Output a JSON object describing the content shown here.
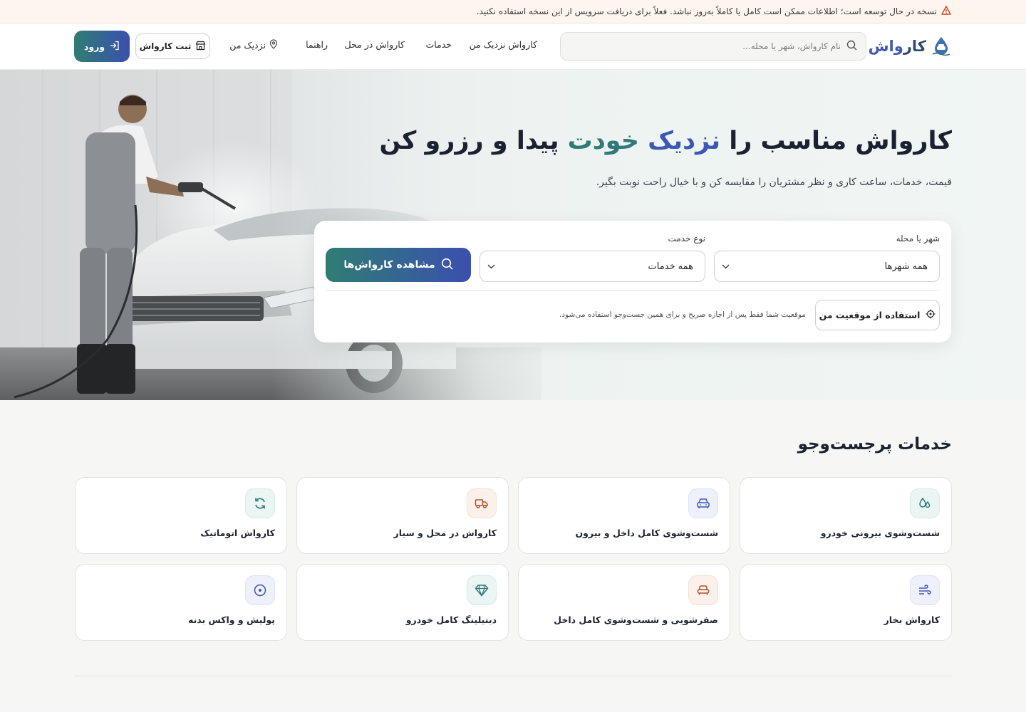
{
  "notice": {
    "text": "نسخه در حال توسعه است؛ اطلاعات ممکن است کامل یا کاملاً به‌روز نباشد. فعلاً برای دریافت سرویس از این نسخه استفاده نکنید."
  },
  "header": {
    "logo_part1": "کار",
    "logo_part2": "واش",
    "search_placeholder": "نام کارواش، شهر یا محله...",
    "nav": {
      "near": "کارواش نزدیک من",
      "services": "خدمات",
      "onsite": "کارواش در محل",
      "guide": "راهنما",
      "near_me": "نزدیک من"
    },
    "register_label": "ثبت کارواش",
    "login_label": "ورود"
  },
  "hero": {
    "title_part1": "کارواش مناسب را ",
    "title_highlight1": "نزدیک ",
    "title_highlight2": "خودت",
    "title_part2": " پیدا و رزرو کن",
    "subtitle": "قیمت، خدمات، ساعت کاری و نظر مشتریان را مقایسه کن و با خیال راحت نوبت بگیر."
  },
  "search_card": {
    "city_label": "شهر یا محله",
    "city_value": "همه شهرها",
    "service_label": "نوع خدمت",
    "service_value": "همه خدمات",
    "view_button": "مشاهده کارواش‌ها",
    "location_button": "استفاده از موقعیت من",
    "location_note": "موقعیت شما فقط پس از اجازه صریح و برای همین جست‌وجو استفاده می‌شود."
  },
  "services": {
    "title": "خدمات پرجست‌وجو",
    "items": [
      {
        "name": "شست‌وشوی بیرونی خودرو",
        "icon": "drops-icon"
      },
      {
        "name": "شست‌وشوی کامل داخل و بیرون",
        "icon": "car-icon"
      },
      {
        "name": "کارواش در محل و سیار",
        "icon": "truck-icon"
      },
      {
        "name": "کارواش اتوماتیک",
        "icon": "refresh-icon"
      },
      {
        "name": "کارواش بخار",
        "icon": "steam-icon"
      },
      {
        "name": "صفرشویی و شست‌وشوی کامل داخل",
        "icon": "seat-icon"
      },
      {
        "name": "دیتیلینگ کامل خودرو",
        "icon": "gem-icon"
      },
      {
        "name": "پولیش و واکس بدنه",
        "icon": "polish-icon"
      }
    ]
  },
  "colors": {
    "brand_blue": "#3d58b4",
    "brand_teal": "#2f7a78",
    "warning": "#c4452b"
  }
}
